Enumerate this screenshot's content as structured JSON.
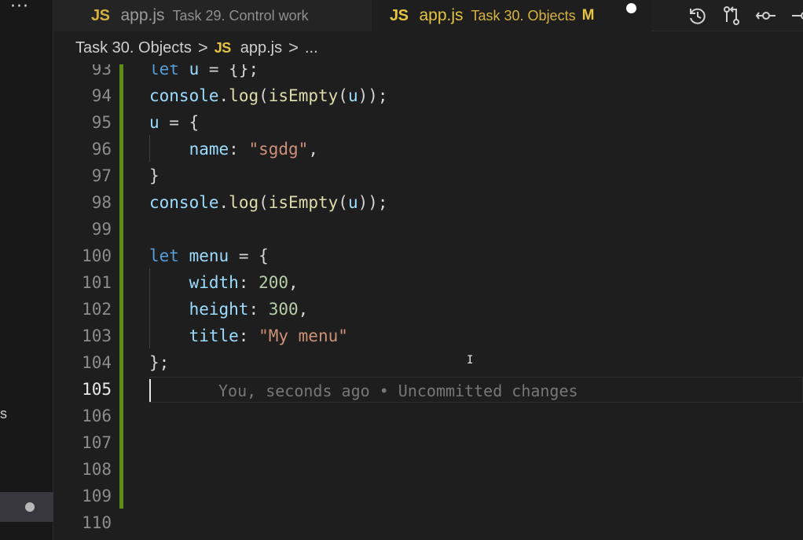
{
  "window": {
    "more_actions_label": "···"
  },
  "tabs": [
    {
      "badge": "JS",
      "file": "app.js",
      "description": "Task 29. Control work",
      "state": "inactive"
    },
    {
      "badge": "JS",
      "file": "app.js",
      "description": "Task 30. Objects",
      "modified": "M",
      "state": "active"
    }
  ],
  "toolbar": {
    "icons": [
      "history-icon",
      "git-compare-icon",
      "source-control-icon",
      "more-icon"
    ]
  },
  "breadcrumb": {
    "folder": "Task 30. Objects",
    "separator": ">",
    "badge": "JS",
    "file": "app.js",
    "ellipsis": "..."
  },
  "sidebar": {
    "fragment_text": "s"
  },
  "editor": {
    "current_line": 105,
    "lines": [
      {
        "number": "93",
        "tokens": [
          {
            "text": "let",
            "kind": "keyword"
          },
          {
            "text": " ",
            "kind": "plain"
          },
          {
            "text": "u",
            "kind": "variable"
          },
          {
            "text": " = {};",
            "kind": "punct"
          }
        ]
      },
      {
        "number": "94",
        "tokens": [
          {
            "text": "console",
            "kind": "variable"
          },
          {
            "text": ".",
            "kind": "punct"
          },
          {
            "text": "log",
            "kind": "function"
          },
          {
            "text": "(",
            "kind": "punct"
          },
          {
            "text": "isEmpty",
            "kind": "function"
          },
          {
            "text": "(",
            "kind": "punct"
          },
          {
            "text": "u",
            "kind": "variable"
          },
          {
            "text": "));",
            "kind": "punct"
          }
        ]
      },
      {
        "number": "95",
        "tokens": [
          {
            "text": "u",
            "kind": "variable"
          },
          {
            "text": " = {",
            "kind": "punct"
          }
        ]
      },
      {
        "number": "96",
        "tokens": [
          {
            "text": "    ",
            "kind": "plain"
          },
          {
            "text": "name",
            "kind": "property"
          },
          {
            "text": ": ",
            "kind": "punct"
          },
          {
            "text": "\"sgdg\"",
            "kind": "string"
          },
          {
            "text": ",",
            "kind": "punct"
          }
        ]
      },
      {
        "number": "97",
        "tokens": [
          {
            "text": "}",
            "kind": "punct"
          }
        ]
      },
      {
        "number": "98",
        "tokens": [
          {
            "text": "console",
            "kind": "variable"
          },
          {
            "text": ".",
            "kind": "punct"
          },
          {
            "text": "log",
            "kind": "function"
          },
          {
            "text": "(",
            "kind": "punct"
          },
          {
            "text": "isEmpty",
            "kind": "function"
          },
          {
            "text": "(",
            "kind": "punct"
          },
          {
            "text": "u",
            "kind": "variable"
          },
          {
            "text": "));",
            "kind": "punct"
          }
        ]
      },
      {
        "number": "99",
        "tokens": []
      },
      {
        "number": "100",
        "tokens": [
          {
            "text": "let",
            "kind": "keyword"
          },
          {
            "text": " ",
            "kind": "plain"
          },
          {
            "text": "menu",
            "kind": "variable"
          },
          {
            "text": " = {",
            "kind": "punct"
          }
        ]
      },
      {
        "number": "101",
        "tokens": [
          {
            "text": "    ",
            "kind": "plain"
          },
          {
            "text": "width",
            "kind": "property"
          },
          {
            "text": ": ",
            "kind": "punct"
          },
          {
            "text": "200",
            "kind": "number"
          },
          {
            "text": ",",
            "kind": "punct"
          }
        ]
      },
      {
        "number": "102",
        "tokens": [
          {
            "text": "    ",
            "kind": "plain"
          },
          {
            "text": "height",
            "kind": "property"
          },
          {
            "text": ": ",
            "kind": "punct"
          },
          {
            "text": "300",
            "kind": "number"
          },
          {
            "text": ",",
            "kind": "punct"
          }
        ]
      },
      {
        "number": "103",
        "tokens": [
          {
            "text": "    ",
            "kind": "plain"
          },
          {
            "text": "title",
            "kind": "property"
          },
          {
            "text": ": ",
            "kind": "punct"
          },
          {
            "text": "\"My menu\"",
            "kind": "string"
          }
        ]
      },
      {
        "number": "104",
        "tokens": [
          {
            "text": "};",
            "kind": "punct"
          }
        ]
      },
      {
        "number": "105",
        "tokens": []
      },
      {
        "number": "106",
        "tokens": []
      },
      {
        "number": "107",
        "tokens": []
      },
      {
        "number": "108",
        "tokens": []
      },
      {
        "number": "109",
        "tokens": []
      },
      {
        "number": "110",
        "tokens": []
      }
    ],
    "blame_text": "You, seconds ago • Uncommitted changes"
  },
  "colors": {
    "accent_js": "#e5c442",
    "change_bar": "#5f8c17",
    "keyword": "#569cd6",
    "string": "#ce9178",
    "number": "#b5cea8"
  }
}
